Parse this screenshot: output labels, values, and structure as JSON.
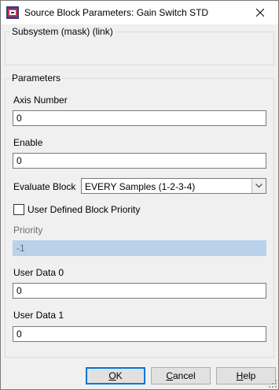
{
  "window": {
    "title": "Source Block Parameters: Gain Switch STD"
  },
  "subsystem": {
    "legend": "Subsystem (mask) (link)"
  },
  "parameters": {
    "legend": "Parameters",
    "axis_number": {
      "label": "Axis Number",
      "value": "0"
    },
    "enable": {
      "label": "Enable",
      "value": "0"
    },
    "evaluate_block": {
      "label": "Evaluate Block",
      "selected": "EVERY Samples (1-2-3-4)"
    },
    "user_priority": {
      "label": "User Defined Block Priority",
      "checked": false
    },
    "priority": {
      "label": "Priority",
      "value": "-1"
    },
    "user_data_0": {
      "label": "User Data 0",
      "value": "0"
    },
    "user_data_1": {
      "label": "User Data 1",
      "value": "0"
    }
  },
  "buttons": {
    "ok_mnemonic": "O",
    "ok_rest": "K",
    "cancel_mnemonic": "C",
    "cancel_rest": "ancel",
    "help_mnemonic": "H",
    "help_rest": "elp"
  },
  "icons": {
    "app": "simulink-block-icon",
    "close": "close-icon",
    "dropdown": "chevron-down-icon",
    "grip": "resize-grip-icon"
  },
  "colors": {
    "disabled_field": "#b9d1ea",
    "default_button_border": "#0078d7"
  }
}
